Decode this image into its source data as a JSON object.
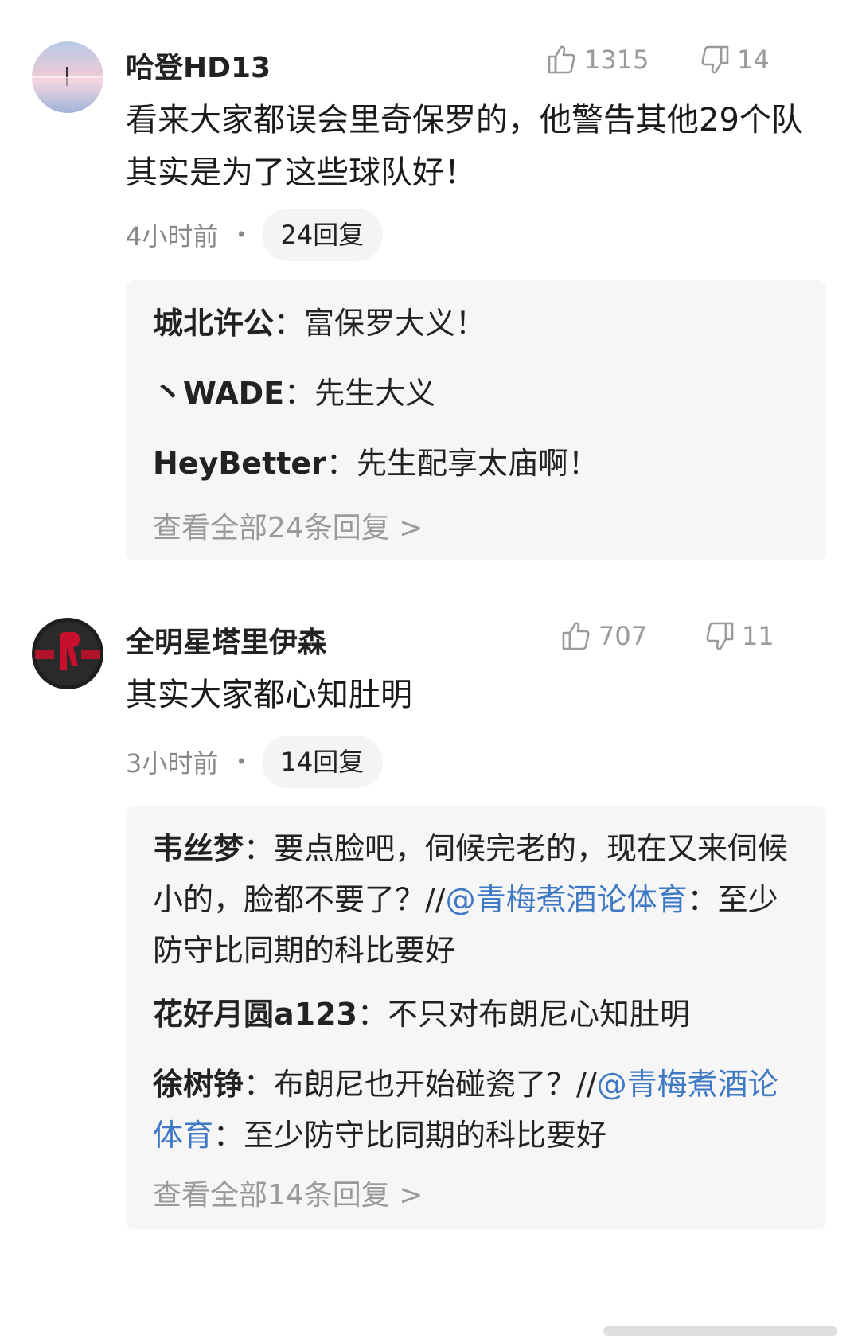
{
  "comments": [
    {
      "username": "哈登HD13",
      "likes": "1315",
      "dislikes": "14",
      "body": "看来大家都误会里奇保罗的，他警告其他29个队其实是为了这些球队好！",
      "time": "4小时前",
      "dot": "•",
      "reply_count": "24回复",
      "replies": [
        {
          "name": "城北许公",
          "sep": "：",
          "text": "富保罗大义！"
        },
        {
          "name": "丶WADE",
          "sep": "：",
          "text": "先生大义"
        },
        {
          "name": "HeyBetter",
          "sep": "：",
          "text": "先生配享太庙啊！"
        }
      ],
      "view_all": "查看全部24条回复 >"
    },
    {
      "username": "全明星塔里伊森",
      "likes": "707",
      "dislikes": "11",
      "body": "其实大家都心知肚明",
      "time": "3小时前",
      "dot": "•",
      "reply_count": "14回复",
      "replies": [
        {
          "name": "韦丝梦",
          "sep": "：",
          "text": "要点脸吧，伺候完老的，现在又来伺候小的，脸都不要了？//",
          "link": "@青梅煮酒论体育",
          "tail": "：至少防守比同期的科比要好"
        },
        {
          "name": "花好月圆a123",
          "sep": "：",
          "text": "不只对布朗尼心知肚明"
        },
        {
          "name": "徐树铮",
          "sep": "：",
          "text": "布朗尼也开始碰瓷了？//",
          "link": "@青梅煮酒论体育",
          "tail": "：至少防守比同期的科比要好"
        }
      ],
      "view_all": "查看全部14条回复 >"
    }
  ],
  "colors": {
    "link": "#3f79c5",
    "muted": "#9a9a9a",
    "reply_bg": "#f6f6f6"
  },
  "icons": {
    "like": "thumbs-up-icon",
    "dislike": "thumbs-down-icon"
  }
}
